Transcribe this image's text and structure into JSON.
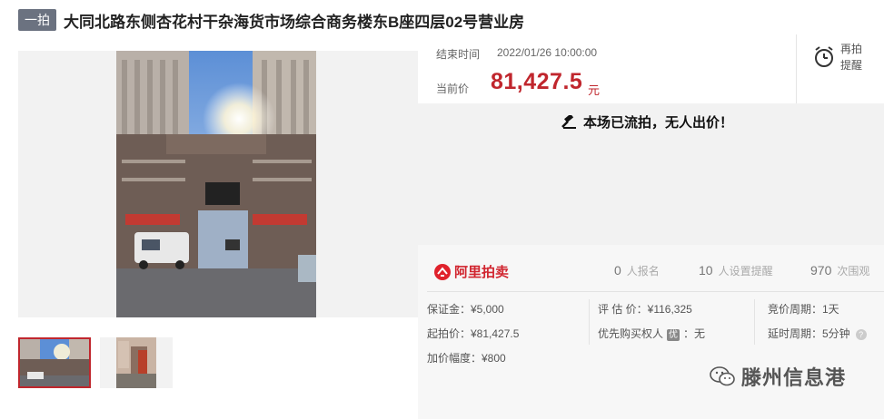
{
  "header": {
    "badge": "一拍",
    "title": "大同北路东侧杏花村干杂海货市场综合商务楼东B座四层02号营业房"
  },
  "auction": {
    "end_label": "结束时间",
    "end_value": "2022/01/26 10:00:00",
    "current_label": "当前价",
    "current_price": "81,427.5",
    "current_unit": "元",
    "remind_label": "再拍提醒",
    "status_text": "本场已流拍，无人出价！"
  },
  "platform": {
    "name": "阿里拍卖"
  },
  "stats": [
    {
      "num": "0",
      "label": "人报名"
    },
    {
      "num": "10",
      "label": "人设置提醒"
    },
    {
      "num": "970",
      "label": "次围观"
    }
  ],
  "details": {
    "deposit": "保证金：¥5,000",
    "start_price": "起拍价：¥81,427.5",
    "increment": "加价幅度：¥800",
    "appraisal": "评 估 价：¥116,325",
    "priority_label": "优先购买权人",
    "priority_badge": "优",
    "priority_value": "无",
    "bid_period": "竞价周期：1天",
    "delay_period": "延时周期：5分钟",
    "help": "?"
  },
  "watermark": {
    "text": "滕州信息港"
  },
  "colors": {
    "accent": "#c0262d",
    "badge": "#6b7280",
    "status_bg": "#f2f2f2"
  }
}
